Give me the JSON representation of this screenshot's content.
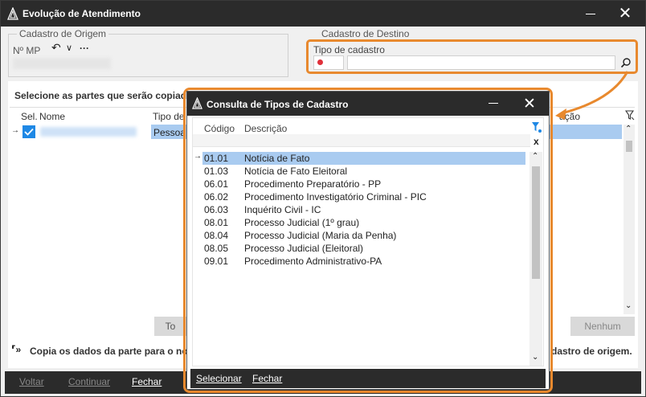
{
  "window": {
    "title": "Evolução de Atendimento"
  },
  "origem": {
    "group_label": "Cadastro de Origem",
    "mp_label": "Nº MP",
    "undo_glyph": "↶",
    "dropdown_glyph": "∨",
    "more_glyph": "···"
  },
  "destino": {
    "group_label": "Cadastro de Destino",
    "field_label": "Tipo de cadastro",
    "code_value": "",
    "desc_value": ""
  },
  "partes": {
    "heading": "Selecione as partes que serão copiadas",
    "columns": [
      "Sel.",
      "Nome",
      "Tipo de",
      "ação"
    ],
    "row": {
      "tipo": "Pessoa"
    },
    "btn_left": "To",
    "btn_nenhum": "Nenhum",
    "info_text_left": "Copia os dados da parte para o novo",
    "info_text_right": "dastro de origem."
  },
  "footer": {
    "voltar": "Voltar",
    "continuar": "Continuar",
    "fechar": "Fechar"
  },
  "modal": {
    "title": "Consulta de Tipos de Cadastro",
    "col_codigo": "Código",
    "col_descricao": "Descrição",
    "clear_glyph": "x",
    "rows": [
      {
        "codigo": "01.01",
        "descricao": "Notícia de Fato"
      },
      {
        "codigo": "01.03",
        "descricao": "Notícia de Fato Eleitoral"
      },
      {
        "codigo": "06.01",
        "descricao": "Procedimento Preparatório - PP"
      },
      {
        "codigo": "06.02",
        "descricao": "Procedimento Investigatório Criminal - PIC"
      },
      {
        "codigo": "06.03",
        "descricao": "Inquérito Civil - IC"
      },
      {
        "codigo": "08.01",
        "descricao": "Processo Judicial (1º grau)"
      },
      {
        "codigo": "08.04",
        "descricao": "Processo Judicial (Maria da Penha)"
      },
      {
        "codigo": "08.05",
        "descricao": "Processo Judicial (Eleitoral)"
      },
      {
        "codigo": "09.01",
        "descricao": "Procedimento Administrativo-PA"
      }
    ],
    "selecionar": "Selecionar",
    "fechar": "Fechar"
  },
  "colors": {
    "accent_orange": "#e8892e",
    "selection_blue": "#a9cbf0",
    "titlebar_dark": "#2b2b2b",
    "required_red": "#e0303a"
  }
}
